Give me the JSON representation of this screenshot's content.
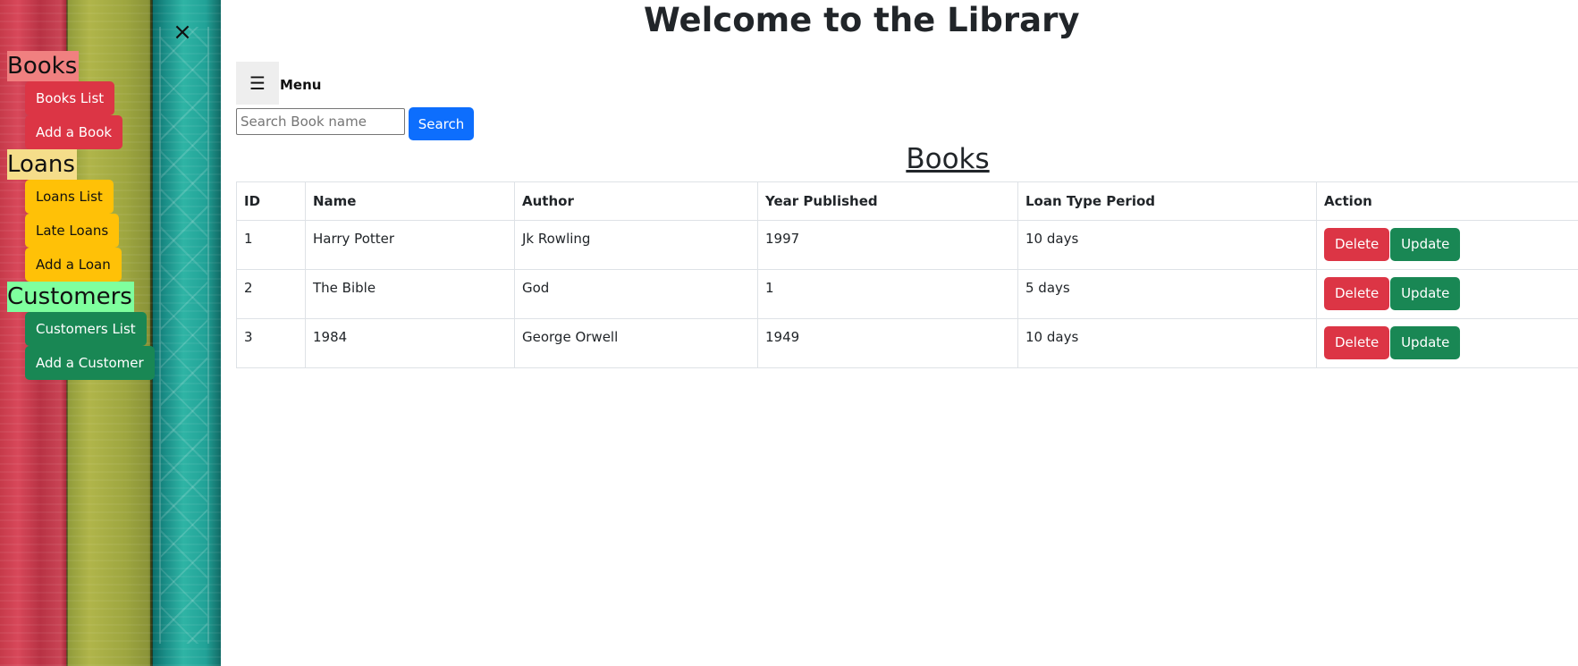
{
  "header": {
    "title": "Welcome to the Library"
  },
  "sidebar": {
    "close_glyph": "×",
    "sections": [
      {
        "title": "Books",
        "items": [
          "Books List",
          "Add a Book"
        ]
      },
      {
        "title": "Loans",
        "items": [
          "Loans List",
          "Late Loans",
          "Add a Loan"
        ]
      },
      {
        "title": "Customers",
        "items": [
          "Customers List",
          "Add a Customer"
        ]
      }
    ],
    "colors": {
      "books": "#dc3545",
      "loans": "#ffc107",
      "customers": "#198754"
    }
  },
  "menu": {
    "toggle_glyph": "☰",
    "label": "Menu"
  },
  "search": {
    "placeholder": "Search Book name",
    "value": "",
    "button_label": "Search"
  },
  "books_section": {
    "heading": "Books",
    "columns": [
      "ID",
      "Name",
      "Author",
      "Year Published",
      "Loan Type Period",
      "Action"
    ],
    "rows": [
      {
        "id": "1",
        "name": "Harry Potter",
        "author": "Jk Rowling",
        "year": "1997",
        "loan_type": "10 days"
      },
      {
        "id": "2",
        "name": "The Bible",
        "author": "God",
        "year": "1",
        "loan_type": "5 days"
      },
      {
        "id": "3",
        "name": "1984",
        "author": "George Orwell",
        "year": "1949",
        "loan_type": "10 days"
      }
    ],
    "delete_label": "Delete",
    "update_label": "Update"
  },
  "colors": {
    "primary": "#0d6efd",
    "danger": "#dc3545",
    "success": "#198754",
    "warning": "#ffc107"
  }
}
